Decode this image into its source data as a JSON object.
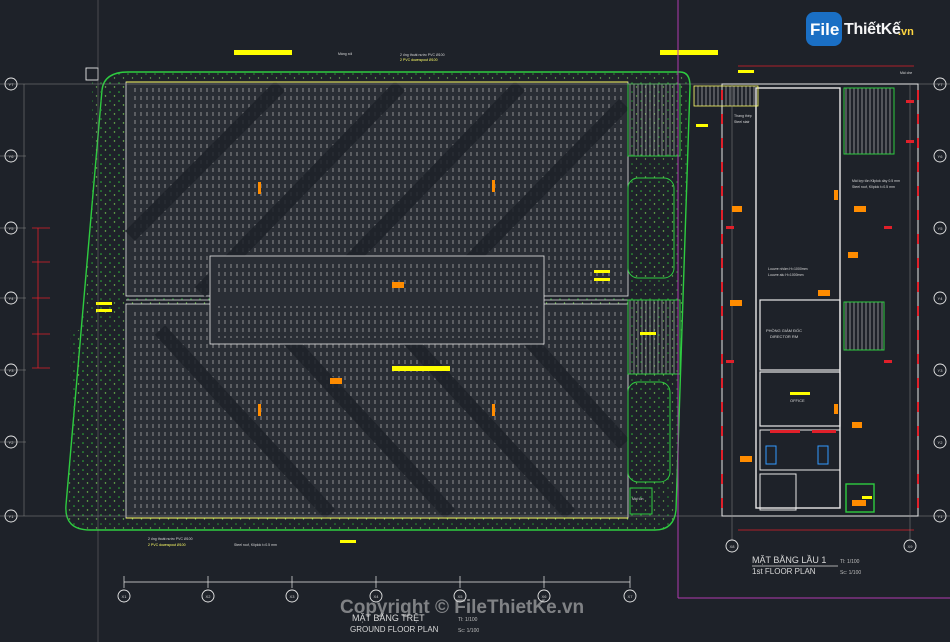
{
  "watermark": {
    "logo_file": "File",
    "logo_rest": "ThiếtKế",
    "logo_tld": ".vn",
    "copyright": "Copyright © FileThietKe.vn"
  },
  "ground_floor": {
    "title_vn": "MẶT BẰNG TRỆT",
    "title_en": "GROUND FLOOR PLAN",
    "scale_1": "Tl: 1/100",
    "scale_2": "Sc: 1/100"
  },
  "first_floor": {
    "title_vn": "MẶT BẰNG LẦU 1",
    "title_en": "1st FLOOR PLAN",
    "scale_1": "Tl: 1/100",
    "scale_2": "Sc: 1/100"
  },
  "rooms": {
    "director": "PHÒNG GIÁM ĐỐC",
    "director_en": "DIRECTOR RM",
    "office": "OFFICE"
  },
  "notes": {
    "gutter_1": "2 ống thoát nước PVC Ø100",
    "gutter_2": "2 PVC downspout Ø100",
    "roof_1": "Mái lợp tôn Kliplok dày 0.5 mm",
    "roof_2": "Steel roof, Kliplok t=0.5 mm",
    "valley": "Máng xối",
    "stair": "Thang thép",
    "stair_en": "Steel stair",
    "window": "Louvre nhôm H=1000mm",
    "window_en": "Louvre alu H=1000mm",
    "roof_short": "Mái tôn",
    "canopy": "Mái che"
  },
  "grid_labels": {
    "left_rows": [
      "Y7",
      "Y6",
      "Y5",
      "Y4",
      "Y3",
      "Y2",
      "Y1"
    ],
    "right_rows": [
      "Y7",
      "Y6",
      "Y5",
      "Y4",
      "Y3",
      "Y2",
      "Y1"
    ],
    "ground_cols": [
      "X1",
      "X2",
      "X3",
      "X4",
      "X5",
      "X6",
      "X7"
    ],
    "first_cols": [
      "X8",
      "X9"
    ]
  },
  "colors": {
    "background": "#1e2229",
    "boundary_green": "#2ecc40",
    "wall_white": "#e8e8e8",
    "dimension_red": "#e0202a",
    "highlight_yellow": "#ffff00",
    "frame_magenta": "#b03ab0",
    "tag_orange": "#ff8c00"
  }
}
